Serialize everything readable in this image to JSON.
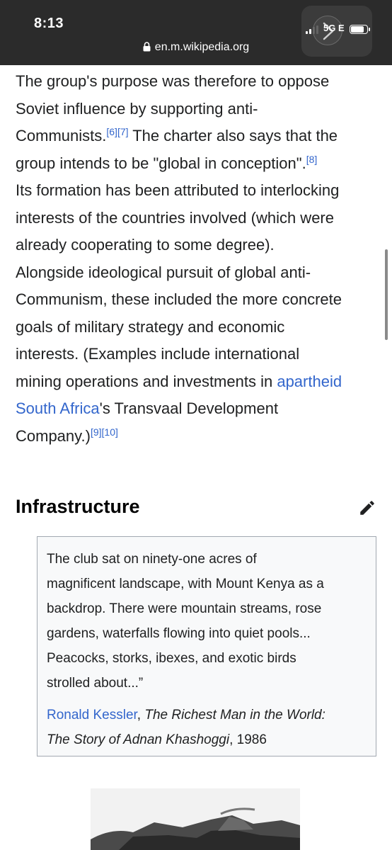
{
  "status_bar": {
    "time": "8:13",
    "network": "5G E",
    "battery_level": 0.85,
    "url": "en.m.wikipedia.org"
  },
  "article": {
    "lines": [
      {
        "text": "The group's purpose was therefore to oppose"
      },
      {
        "text": "Soviet influence by supporting anti-"
      },
      {
        "pre": "Communists.",
        "refs": [
          "[6]",
          "[7]"
        ],
        "post": " The charter also says that the"
      },
      {
        "pre": "group intends to be \"global in conception\".",
        "refs": [
          "[8]"
        ]
      },
      {
        "text": "Its formation has been attributed to interlocking"
      },
      {
        "text": "interests of the countries involved (which were"
      },
      {
        "text": "already cooperating to some degree)."
      },
      {
        "text": "Alongside ideological pursuit of global anti-"
      },
      {
        "text": "Communism, these included the more concrete"
      },
      {
        "text": "goals of military strategy and economic"
      },
      {
        "text": "interests. (Examples include international"
      },
      {
        "pre": "mining operations and investments in ",
        "link": "apartheid"
      },
      {
        "link": "South Africa",
        "post": "'s Transvaal Development"
      },
      {
        "pre": "Company.)",
        "refs": [
          "[9]",
          "[10]"
        ]
      }
    ]
  },
  "section": {
    "title": "Infrastructure"
  },
  "quote": {
    "lines": [
      "The club sat on ninety-one acres of",
      "magnificent landscape, with Mount Kenya as a",
      "backdrop. There were mountain streams, rose",
      "gardens, waterfalls flowing into quiet pools...",
      "Peacocks, storks, ibexes, and exotic birds",
      "strolled about...”"
    ],
    "author": "Ronald Kessler",
    "sep": ", ",
    "title_line1": "The Richest Man in the World:",
    "title_line2": "The Story of Adnan Khashoggi",
    "year": ", 1986"
  }
}
